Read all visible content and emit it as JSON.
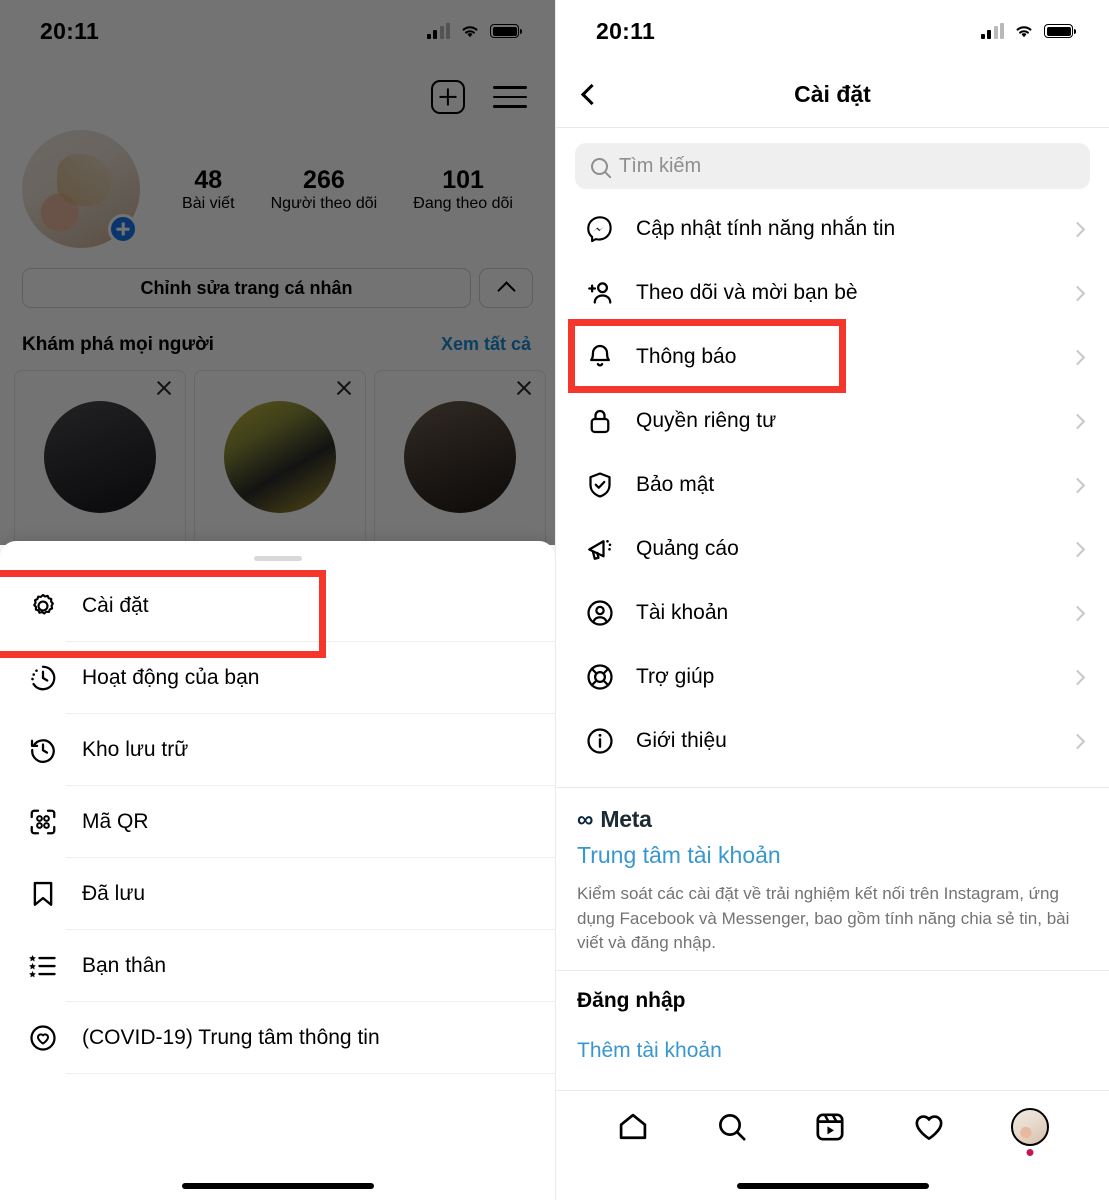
{
  "left_screen": {
    "status_bar": {
      "time": "20:11",
      "signal_icon": "cellular-signal-icon",
      "wifi_icon": "wifi-icon",
      "battery_icon": "battery-icon"
    },
    "profile": {
      "username": "",
      "full_name": "",
      "bio": "",
      "add_story_icon": "add-story-plus-icon",
      "new_post_icon": "new-post-plus-icon",
      "menu_icon": "hamburger-menu-icon",
      "stats": [
        {
          "number": "48",
          "label": "Bài viết"
        },
        {
          "number": "266",
          "label": "Người theo dõi"
        },
        {
          "number": "101",
          "label": "Đang theo dõi"
        }
      ],
      "edit_profile_label": "Chỉnh sửa trang cá nhân",
      "collapse_icon": "chevron-up-icon"
    },
    "discover": {
      "title": "Khám phá mọi người",
      "see_all": "Xem tất cả",
      "dismiss_icon": "close-x-icon"
    },
    "bottom_sheet": {
      "items": [
        {
          "label": "Cài đặt",
          "icon": "gear-settings-icon"
        },
        {
          "label": "Hoạt động của bạn",
          "icon": "activity-clock-icon"
        },
        {
          "label": "Kho lưu trữ",
          "icon": "archive-history-icon"
        },
        {
          "label": "Mã QR",
          "icon": "qr-code-icon"
        },
        {
          "label": "Đã lưu",
          "icon": "bookmark-saved-icon"
        },
        {
          "label": "Bạn thân",
          "icon": "close-friends-list-icon"
        },
        {
          "label": "(COVID-19) Trung tâm thông tin",
          "icon": "covid-heart-icon"
        }
      ]
    },
    "highlight_label": "Cài đặt"
  },
  "right_screen": {
    "status_bar": {
      "time": "20:11",
      "signal_icon": "cellular-signal-icon",
      "wifi_icon": "wifi-icon",
      "battery_icon": "battery-icon"
    },
    "nav": {
      "title": "Cài đặt",
      "back_icon": "chevron-left-back-icon"
    },
    "search": {
      "placeholder": "Tìm kiếm",
      "value": "",
      "icon": "search-magnifier-icon"
    },
    "settings_items": [
      {
        "label": "Cập nhật tính năng nhắn tin",
        "icon": "messenger-icon"
      },
      {
        "label": "Theo dõi và mời bạn bè",
        "icon": "add-person-icon"
      },
      {
        "label": "Thông báo",
        "icon": "bell-notification-icon"
      },
      {
        "label": "Quyền riêng tư",
        "icon": "lock-privacy-icon"
      },
      {
        "label": "Bảo mật",
        "icon": "shield-check-security-icon"
      },
      {
        "label": "Quảng cáo",
        "icon": "megaphone-ads-icon"
      },
      {
        "label": "Tài khoản",
        "icon": "account-person-circle-icon"
      },
      {
        "label": "Trợ giúp",
        "icon": "lifebuoy-help-icon"
      },
      {
        "label": "Giới thiệu",
        "icon": "info-circle-icon"
      }
    ],
    "meta": {
      "brand_glyph": "∞",
      "brand_name": "Meta",
      "link": "Trung tâm tài khoản",
      "description": "Kiểm soát các cài đặt về trải nghiệm kết nối trên Instagram, ứng dụng Facebook và Messenger, bao gồm tính năng chia sẻ tin, bài viết và đăng nhập."
    },
    "login_section": {
      "title": "Đăng nhập",
      "add_account": "Thêm tài khoản"
    },
    "tabbar": {
      "items": [
        {
          "name": "home-icon"
        },
        {
          "name": "search-icon"
        },
        {
          "name": "reels-icon"
        },
        {
          "name": "heart-activity-icon"
        },
        {
          "name": "profile-avatar-icon"
        }
      ]
    },
    "highlight_label": "Thông báo"
  },
  "colors": {
    "accent_link": "#3897cf",
    "highlight_red": "#f5372b",
    "story_blue": "#1877f2",
    "muted_text": "#8e8e8e",
    "badge_dot": "#c2185b"
  }
}
